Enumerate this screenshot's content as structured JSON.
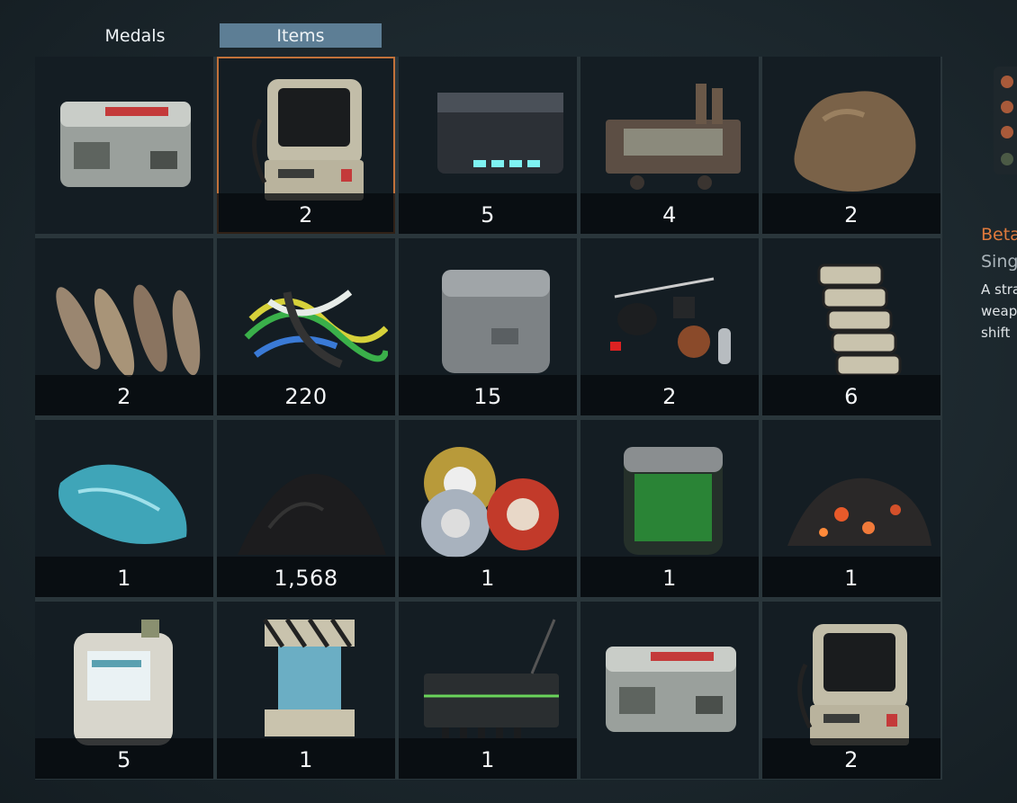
{
  "tabs": {
    "medals": "Medals",
    "items": "Items",
    "active": "Items"
  },
  "items": [
    {
      "icon": "supply-crate-icon",
      "qty": ""
    },
    {
      "icon": "portable-terminal-icon",
      "qty": "2",
      "selected": true
    },
    {
      "icon": "battery-pack-icon",
      "qty": "5"
    },
    {
      "icon": "scrap-machinery-icon",
      "qty": "4"
    },
    {
      "icon": "rock-ore-icon",
      "qty": "2"
    },
    {
      "icon": "bone-shards-icon",
      "qty": "2"
    },
    {
      "icon": "wire-bundle-icon",
      "qty": "220"
    },
    {
      "icon": "metal-cube-icon",
      "qty": "15"
    },
    {
      "icon": "electronic-components-icon",
      "qty": "2"
    },
    {
      "icon": "ceramic-plates-icon",
      "qty": "6"
    },
    {
      "icon": "blue-crystal-icon",
      "qty": "1"
    },
    {
      "icon": "black-powder-icon",
      "qty": "1,568"
    },
    {
      "icon": "tape-rolls-icon",
      "qty": "1"
    },
    {
      "icon": "green-canister-icon",
      "qty": "1"
    },
    {
      "icon": "burning-coal-icon",
      "qty": "1"
    },
    {
      "icon": "coolant-jug-icon",
      "qty": "5"
    },
    {
      "icon": "energy-cell-icon",
      "qty": "1"
    },
    {
      "icon": "circuit-board-icon",
      "qty": "1"
    },
    {
      "icon": "supply-crate-icon",
      "qty": ""
    },
    {
      "icon": "portable-terminal-icon",
      "qty": "2"
    }
  ],
  "detail": {
    "title": "Beta",
    "subtitle": "Sing",
    "desc_lines": [
      "A stra",
      "weap",
      "shift"
    ]
  },
  "colors": {
    "accent": "#e07a3c",
    "tab_active": "#5d7e95",
    "selected_border": "#c2723a"
  }
}
